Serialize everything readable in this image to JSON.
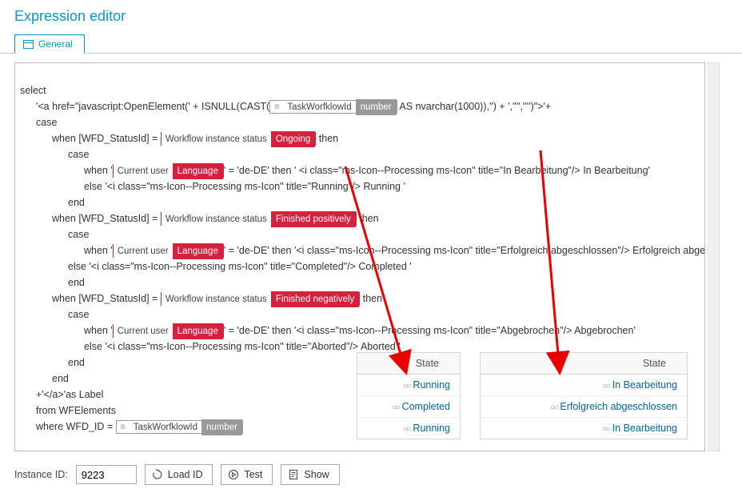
{
  "title": "Expression editor",
  "tab": {
    "label": "General"
  },
  "tokens": {
    "taskWorkflowId": {
      "name": "TaskWorfklowId",
      "type": "number"
    },
    "wfStatus": {
      "name": "Workflow instance status"
    },
    "wfStatusOngoing": "Ongoing",
    "wfStatusFinPos": "Finished positively",
    "wfStatusFinNeg": "Finished negatively",
    "curUser": {
      "name": "Current user",
      "attr": "Language"
    }
  },
  "code": {
    "l1": "select",
    "l2a": "'<a href=\"javascript:OpenElement(' + ISNULL(CAST(",
    "l2b": " AS nvarchar(1000)),'') + ','''','''')\">'+",
    "l3": "case",
    "l4a": "when [WFD_StatusId] = ",
    "l4b": " then",
    "l5": "case",
    "l6a": "when '",
    "l6b": "' = 'de-DE' then ' <i class=\"ms-Icon--Processing ms-Icon\" title=\"In Bearbeitung\"/> In Bearbeitung'",
    "l7": "else '<i class=\"ms-Icon--Processing ms-Icon\" title=\"Running\"/> Running '",
    "l8": "end",
    "l9a": "when [WFD_StatusId] = ",
    "l9b": " then",
    "l10": "case",
    "l11a": "when '",
    "l11b": "' = 'de-DE' then '<i class=\"ms-Icon--Processing ms-Icon\" title=\"Erfolgreich abgeschlossen\"/> Erfolgreich abgeschlossen'",
    "l12": "else '<i class=\"ms-Icon--Processing ms-Icon\" title=\"Completed\"/> Completed '",
    "l13": "end",
    "l14a": "when [WFD_StatusId] = ",
    "l14b": " then",
    "l15": "case",
    "l16a": "when '",
    "l16b": "' = 'de-DE' then '<i class=\"ms-Icon--Processing ms-Icon\" title=\"Abgebrochen\"/> Abgebrochen'",
    "l17": "else '<i class=\"ms-Icon--Processing ms-Icon\" title=\"Aborted\"/> Aborted '",
    "l18": "end",
    "l19": "end",
    "l20": "+'</a>'as Label",
    "l21": "from WFElements",
    "l22a": "where WFD_ID = "
  },
  "preview1": {
    "header": "State",
    "rows": [
      "Running",
      "Completed",
      "Running"
    ]
  },
  "preview2": {
    "header": "State",
    "rows": [
      "In Bearbeitung",
      "Erfolgreich abgeschlossen",
      "In Bearbeitung"
    ]
  },
  "footer": {
    "instanceLabel": "Instance ID:",
    "instanceValue": "9223",
    "loadId": "Load ID",
    "test": "Test",
    "show": "Show"
  }
}
